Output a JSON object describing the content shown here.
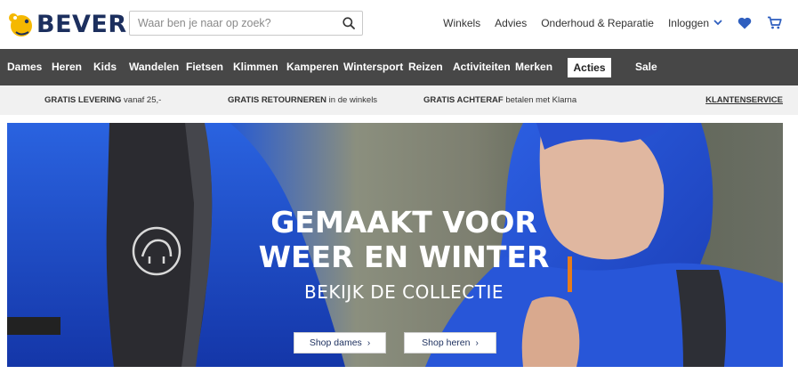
{
  "brand": {
    "name": "BEVER",
    "colors": {
      "logo_yellow": "#f5b800",
      "logo_navy": "#1c2f5e"
    }
  },
  "search": {
    "placeholder": "Waar ben je naar op zoek?",
    "value": "",
    "icon": "search-icon"
  },
  "topnav": {
    "links": [
      "Winkels",
      "Advies",
      "Onderhoud & Reparatie"
    ],
    "login": "Inloggen",
    "icons": [
      "heart-icon",
      "cart-icon"
    ],
    "accent": "#2f5fbf"
  },
  "mainnav": {
    "items": [
      "Dames",
      "Heren",
      "Kids",
      "Wandelen",
      "Fietsen",
      "Klimmen",
      "Kamperen",
      "Wintersport",
      "Reizen",
      "Activiteiten",
      "Merken"
    ],
    "highlight": "Acties",
    "sale": "Sale",
    "bg": "#474747"
  },
  "usp": {
    "items": [
      {
        "bold": "GRATIS LEVERING",
        "text": " vanaf 25,-"
      },
      {
        "bold": "GRATIS RETOURNEREN",
        "text": " in de winkels"
      },
      {
        "bold": "GRATIS ACHTERAF",
        "text": " betalen met Klarna"
      }
    ],
    "service": "KLANTENSERVICE"
  },
  "hero": {
    "line1": "GEMAAKT VOOR",
    "line2": "WEER EN WINTER",
    "subtitle": "BEKIJK DE COLLECTIE",
    "buttons": [
      "Shop dames",
      "Shop heren"
    ]
  }
}
